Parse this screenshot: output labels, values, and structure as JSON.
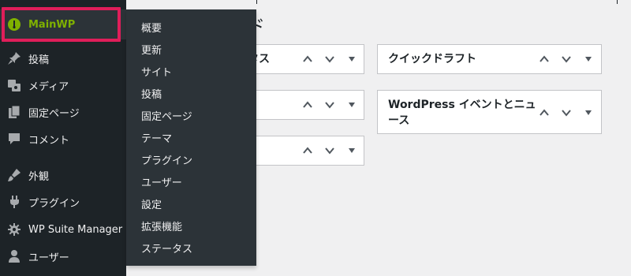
{
  "sidebar": {
    "items": [
      {
        "label": "MainWP",
        "icon": "mainwp-icon"
      },
      {
        "label": "投稿",
        "icon": "pin-icon"
      },
      {
        "label": "メディア",
        "icon": "media-icon"
      },
      {
        "label": "固定ページ",
        "icon": "pages-icon"
      },
      {
        "label": "コメント",
        "icon": "comment-icon"
      },
      {
        "label": "外観",
        "icon": "brush-icon"
      },
      {
        "label": "プラグイン",
        "icon": "plugin-icon"
      },
      {
        "label": "WP Suite Manager",
        "icon": "gear-icon"
      },
      {
        "label": "ユーザー",
        "icon": "user-icon"
      }
    ]
  },
  "flyout": {
    "items": [
      "概要",
      "更新",
      "サイト",
      "投稿",
      "固定ページ",
      "テーマ",
      "プラグイン",
      "ユーザー",
      "設定",
      "拡張機能",
      "ステータス"
    ]
  },
  "main": {
    "heading_fragment": "ド",
    "boxes": {
      "box1_title_fragment": "タス",
      "quick_draft_title": "クイックドラフト",
      "events_title_line1": "WordPress イベントとニュ",
      "events_title_line2": "ース"
    }
  },
  "colors": {
    "sidebar_bg": "#1d2327",
    "flyout_bg": "#2c3338",
    "mainwp_accent": "#7fb100",
    "highlight": "#e01e5a"
  }
}
